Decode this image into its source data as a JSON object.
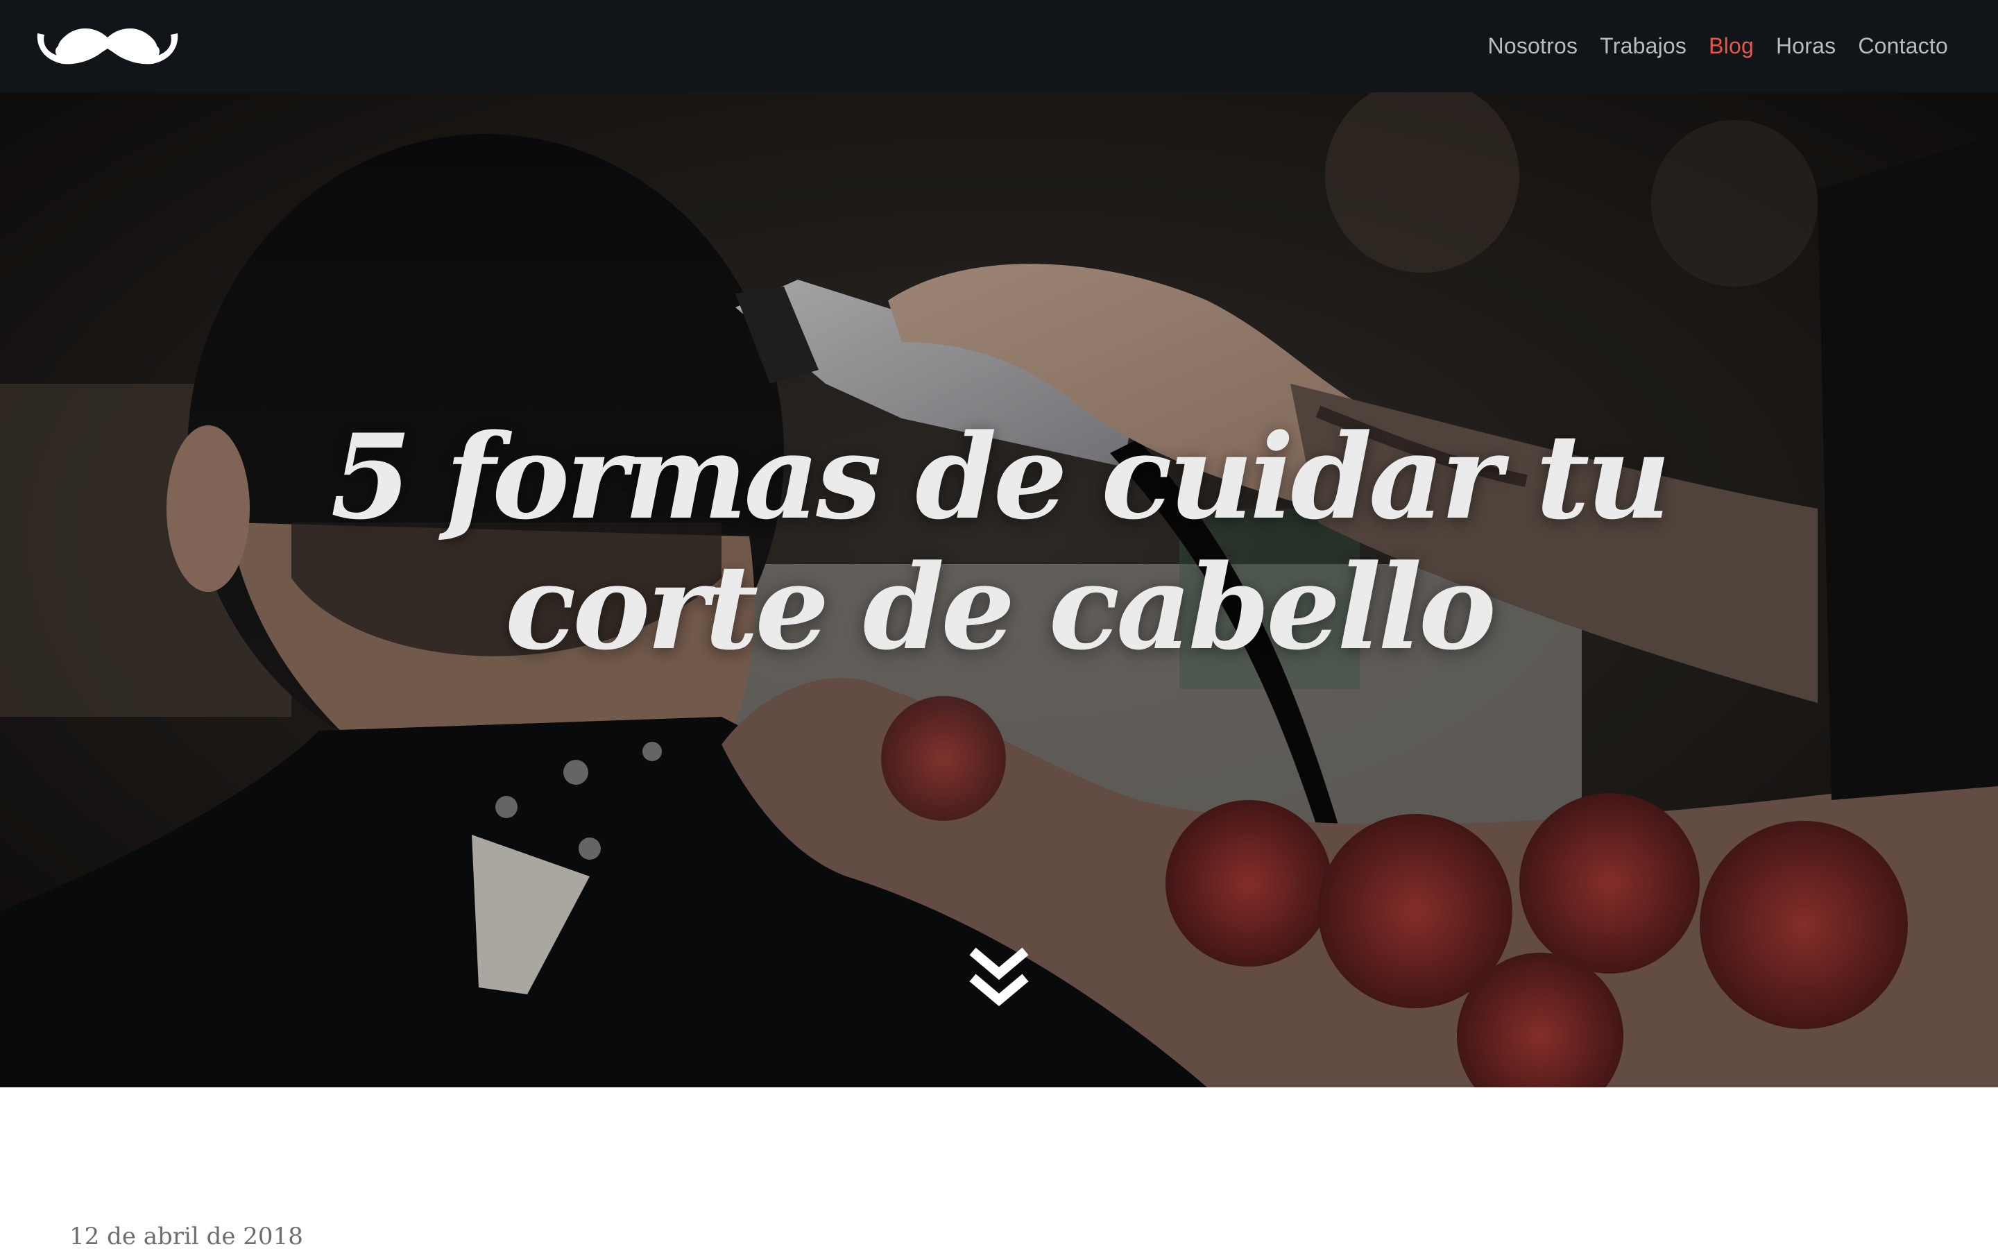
{
  "nav": {
    "logo_icon": "mustache-icon",
    "links": [
      {
        "label": "Nosotros",
        "active": false
      },
      {
        "label": "Trabajos",
        "active": false
      },
      {
        "label": "Blog",
        "active": true
      },
      {
        "label": "Horas",
        "active": false
      },
      {
        "label": "Contacto",
        "active": false
      }
    ]
  },
  "hero": {
    "title": "5 formas de cuidar tu corte de cabello",
    "scroll_icon": "double-chevron-down-icon"
  },
  "article": {
    "date": "12 de abril de 2018"
  },
  "colors": {
    "navbar_bg": "#11151a",
    "nav_text": "#b8bcc1",
    "accent": "#e8564b",
    "hero_title": "#ebebeb",
    "page_bg": "#ffffff"
  }
}
